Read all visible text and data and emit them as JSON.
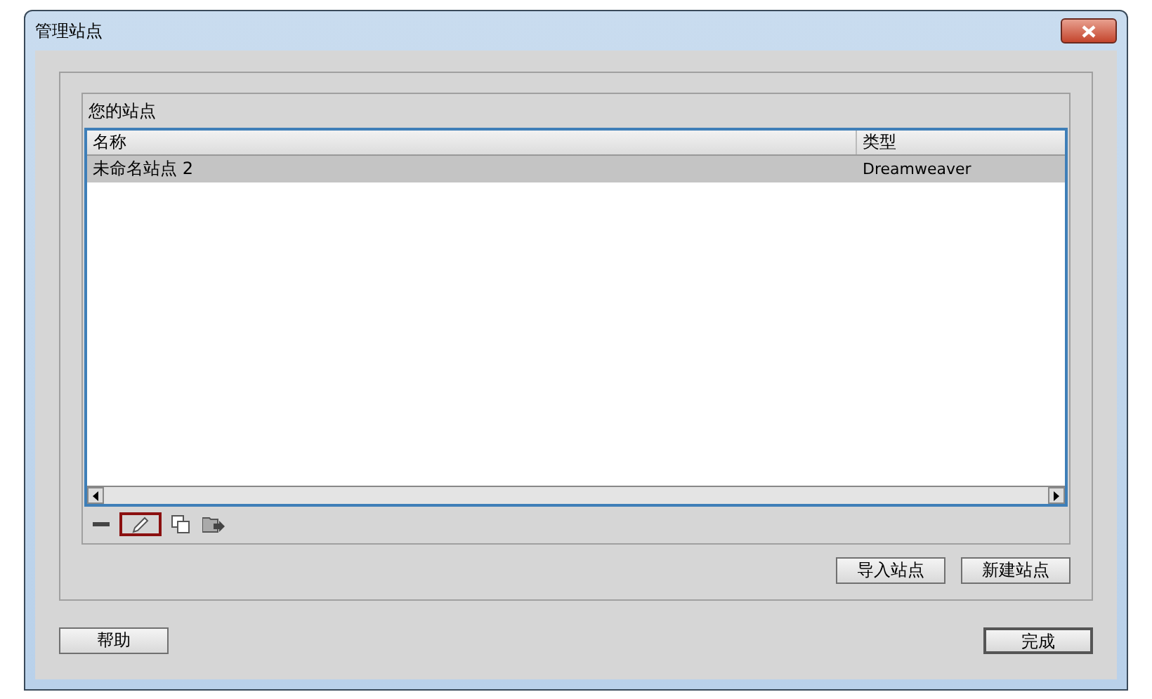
{
  "window": {
    "title": "管理站点"
  },
  "group": {
    "label": "您的站点"
  },
  "table": {
    "columns": [
      "名称",
      "类型"
    ],
    "rows": [
      {
        "cells": [
          "未命名站点 2",
          "Dreamweaver"
        ],
        "selected": true
      }
    ]
  },
  "tools": [
    {
      "kind": "remove",
      "highlighted": false
    },
    {
      "kind": "edit",
      "highlighted": true
    },
    {
      "kind": "duplicate",
      "highlighted": false
    },
    {
      "kind": "export",
      "highlighted": false
    }
  ],
  "site_buttons": [
    "导入站点",
    "新建站点"
  ],
  "footer": {
    "help": "帮助",
    "done": "完成"
  }
}
